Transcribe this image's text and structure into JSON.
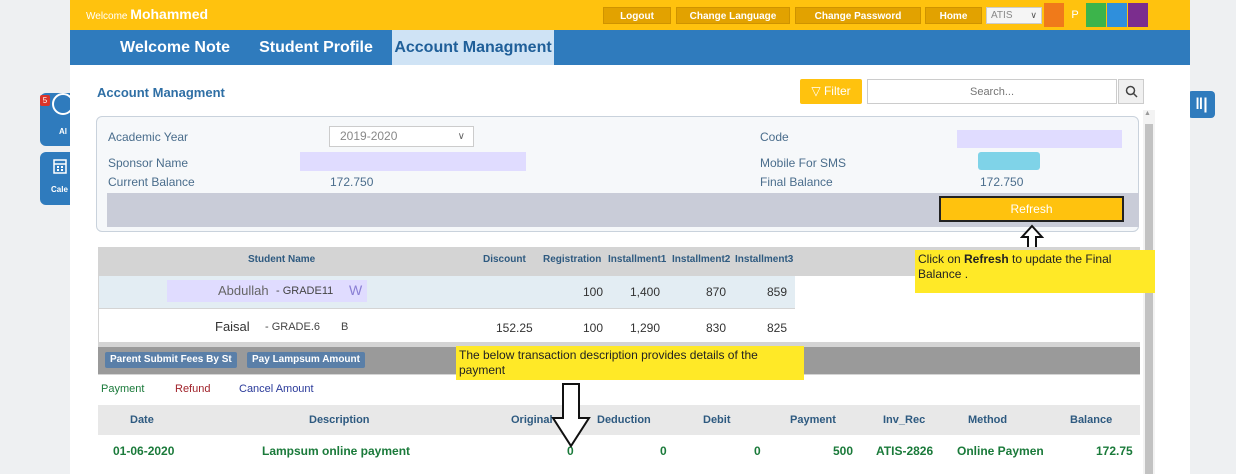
{
  "header": {
    "welcome_prefix": "Welcome",
    "user_name": "Mohammed",
    "buttons": {
      "logout": "Logout",
      "change_language": "Change Language",
      "change_password": "Change Password",
      "home": "Home"
    },
    "school_select": "ATIS",
    "profile_initial": "P",
    "colors": {
      "bar": "#ffc20e",
      "swatches": [
        "#f07a1a",
        "#ffc20e",
        "#3cb44b",
        "#2f8fdc",
        "#7b2d8e"
      ]
    }
  },
  "nav": {
    "tabs": [
      "Welcome Note",
      "Student Profile",
      "Account Managment"
    ],
    "active": "Account Managment"
  },
  "sidebar": {
    "alert_badge": "5",
    "alert_label": "Al",
    "calendar_label": "Cale"
  },
  "page": {
    "title": "Account Managment",
    "filter_label": "Filter",
    "search_placeholder": "Search..."
  },
  "account_info": {
    "academic_year_label": "Academic Year",
    "academic_year": "2019-2020",
    "sponsor_name_label": "Sponsor Name",
    "current_balance_label": "Current Balance",
    "current_balance": "172.750",
    "code_label": "Code",
    "mobile_label": "Mobile For SMS",
    "final_balance_label": "Final Balance",
    "final_balance": "172.750",
    "refresh_label": "Refresh"
  },
  "students": {
    "headers": [
      "Student Name",
      "Discount",
      "Registration",
      "Installment1",
      "Installment2",
      "Installment3"
    ],
    "rows": [
      {
        "name": "Abdullah",
        "grade": "- GRADE11",
        "section": "W",
        "discount": "",
        "registration": "100",
        "inst1": "1,400",
        "inst2": "870",
        "inst3": "859"
      },
      {
        "name": "Faisal",
        "grade": "- GRADE.6",
        "section": "B",
        "discount": "152.25",
        "registration": "100",
        "inst1": "1,290",
        "inst2": "830",
        "inst3": "825"
      }
    ],
    "actions": [
      "Parent Submit Fees By St",
      "Pay Lampsum Amount"
    ]
  },
  "callouts": {
    "refresh_pre": "Click on ",
    "refresh_bold": "Refresh",
    "refresh_post": " to update the Final Balance .",
    "transaction": "The below transaction description provides details of the payment"
  },
  "legend": {
    "payment": "Payment",
    "refund": "Refund",
    "cancel": "Cancel Amount"
  },
  "transactions": {
    "headers": [
      "Date",
      "Description",
      "Original",
      "Deduction",
      "Debit",
      "Payment",
      "Inv_Rec",
      "Method",
      "Balance"
    ],
    "rows": [
      {
        "date": "01-06-2020",
        "description": "Lampsum online payment",
        "original": "0",
        "deduction": "0",
        "debit": "0",
        "payment": "500",
        "inv_rec": "ATIS-2826",
        "method": "Online Payment",
        "balance": "172.75"
      }
    ]
  }
}
